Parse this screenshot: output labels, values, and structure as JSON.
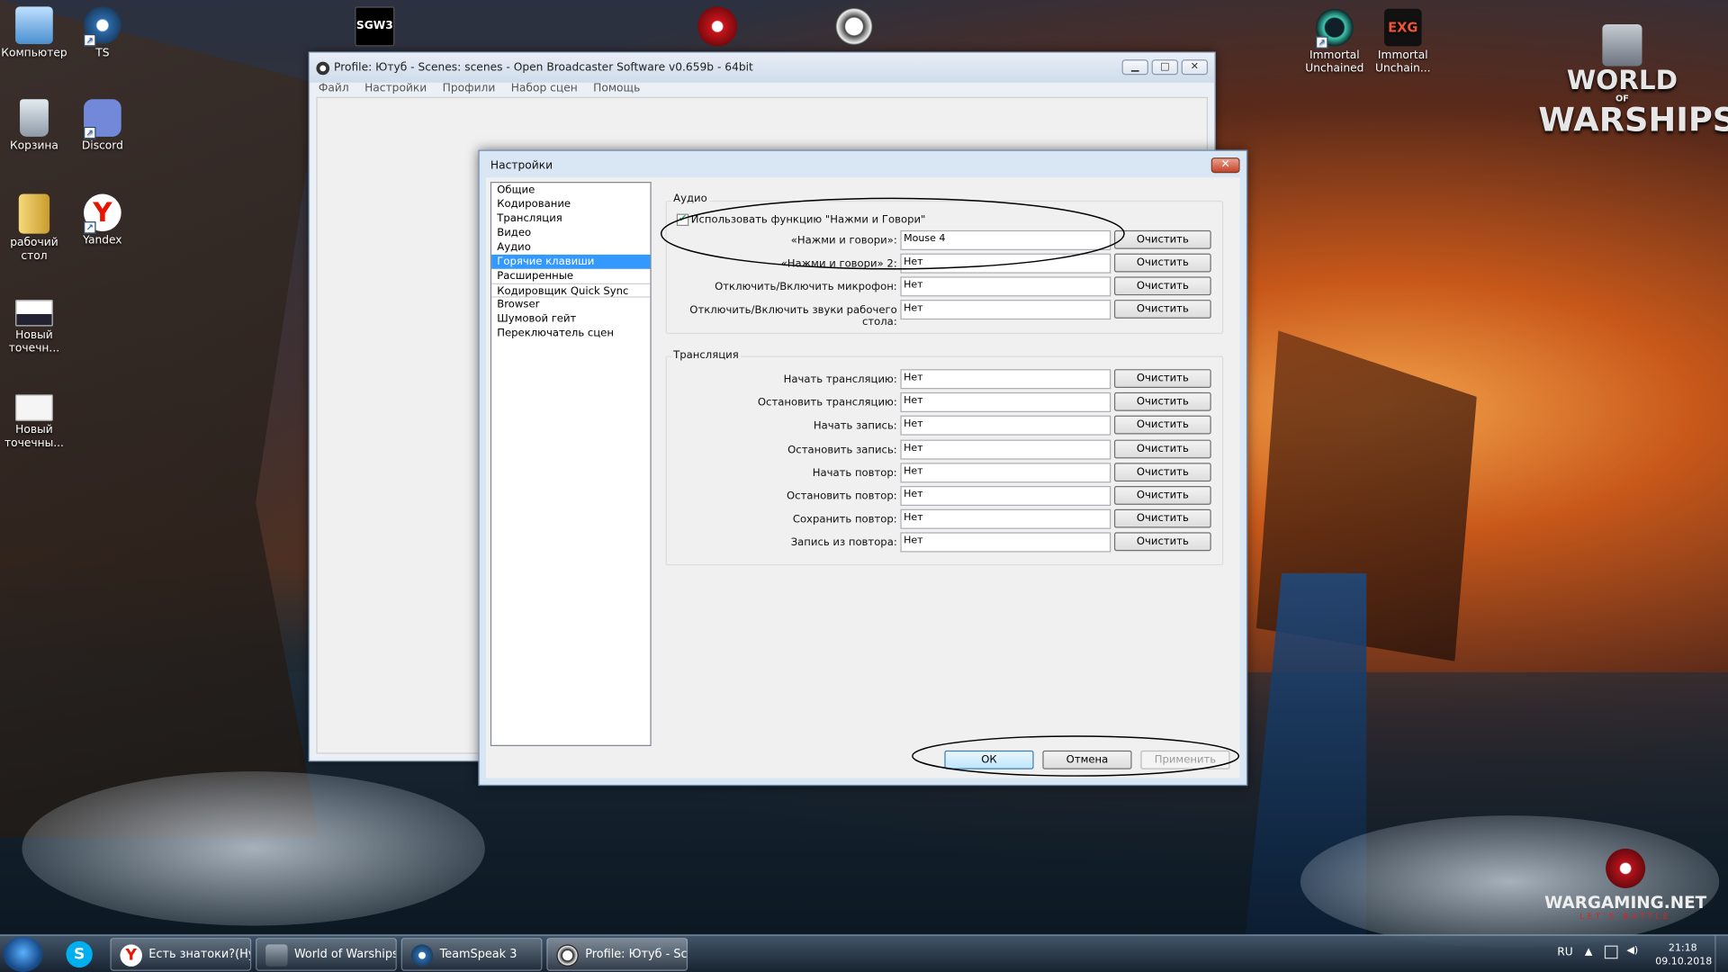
{
  "desktop": {
    "icons": [
      {
        "label": "Компьютер",
        "icon": "computer-icon",
        "color": "#8fc3ff",
        "shortcut": false
      },
      {
        "label": "TS",
        "icon": "teamspeak-icon",
        "color": "#2a6aa8",
        "shortcut": true
      },
      {
        "label": "Корзина",
        "icon": "recycle-bin-icon",
        "color": "#c9d3de",
        "shortcut": false
      },
      {
        "label": "Discord",
        "icon": "discord-icon",
        "color": "#7289da",
        "shortcut": true
      },
      {
        "label": "рабочий стол",
        "icon": "folder-icon",
        "color": "#e8c45a",
        "shortcut": false
      },
      {
        "label": "Yandex",
        "icon": "yandex-browser-icon",
        "color": "#e61400",
        "shortcut": true
      },
      {
        "label": "Новый точечн...",
        "icon": "bitmap-image-icon",
        "color": "#f2f2f2",
        "shortcut": false
      },
      {
        "label": "Новый точечны...",
        "icon": "bitmap-image-icon",
        "color": "#f2f2f2",
        "shortcut": false
      }
    ],
    "right_icons": [
      {
        "label": "Immortal Unchained",
        "icon": "immortal-unchained-icon"
      },
      {
        "label": "Immortal Unchain...",
        "icon": "exe-icon"
      }
    ],
    "top_icons": [
      {
        "icon": "sgw3-icon",
        "text": "SGW3"
      },
      {
        "icon": "wargaming-center-icon"
      },
      {
        "icon": "obs-icon"
      }
    ],
    "logo_line1": "WORLD",
    "logo_line2": "OF",
    "logo_line3": "WARSHIPS",
    "wargaming": "WARGAMING.NET",
    "wargaming_sub": "LET'S BATTLE"
  },
  "obs_window": {
    "title": "Profile: Ютуб - Scenes: scenes - Open Broadcaster Software v0.659b - 64bit",
    "menu": [
      "Файл",
      "Настройки",
      "Профили",
      "Набор сцен",
      "Помощь"
    ],
    "minimize": "▁",
    "maximize": "□",
    "close": "✕"
  },
  "settings": {
    "title": "Настройки",
    "close": "✕",
    "nav": [
      "Общие",
      "Кодирование",
      "Трансляция",
      "Видео",
      "Аудио",
      "Горячие клавиши",
      "Расширенные",
      "Кодировщик Quick Sync",
      "Browser",
      "Шумовой гейт",
      "Переключатель сцен"
    ],
    "selected_nav": "Горячие клавиши",
    "audio_group": "Аудио",
    "push_to_talk_checkbox": "Использовать функцию \"Нажми и Говори\"",
    "push_to_talk_checked": true,
    "audio_rows": [
      {
        "label": "«Нажми и говори»:",
        "value": "Mouse 4",
        "button": "Очистить"
      },
      {
        "label": "«Нажми и говори» 2:",
        "value": "Нет",
        "button": "Очистить"
      },
      {
        "label": "Отключить/Включить микрофон:",
        "value": "Нет",
        "button": "Очистить"
      },
      {
        "label": "Отключить/Включить звуки рабочего стола:",
        "value": "Нет",
        "button": "Очистить"
      }
    ],
    "stream_group": "Трансляция",
    "stream_rows": [
      {
        "label": "Начать трансляцию:",
        "value": "Нет",
        "button": "Очистить"
      },
      {
        "label": "Остановить трансляцию:",
        "value": "Нет",
        "button": "Очистить"
      },
      {
        "label": "Начать запись:",
        "value": "Нет",
        "button": "Очистить"
      },
      {
        "label": "Остановить запись:",
        "value": "Нет",
        "button": "Очистить"
      },
      {
        "label": "Начать повтор:",
        "value": "Нет",
        "button": "Очистить"
      },
      {
        "label": "Остановить повтор:",
        "value": "Нет",
        "button": "Очистить"
      },
      {
        "label": "Сохранить повтор:",
        "value": "Нет",
        "button": "Очистить"
      },
      {
        "label": "Запись из повтора:",
        "value": "Нет",
        "button": "Очистить"
      }
    ],
    "ok": "ОК",
    "cancel": "Отмена",
    "apply": "Применить"
  },
  "taskbar": {
    "items": [
      {
        "label": "Есть знатоки?(Ну...",
        "icon": "yandex-browser-icon",
        "color": "#e61400"
      },
      {
        "label": "World of Warships",
        "icon": "world-of-warships-icon",
        "color": "#5a6a7a"
      },
      {
        "label": "TeamSpeak 3",
        "icon": "teamspeak-icon",
        "color": "#2a6aa8"
      },
      {
        "label": "Profile: Ютуб - Sc...",
        "icon": "obs-icon",
        "color": "#303030"
      }
    ],
    "skype_icon": "skype-icon",
    "lang": "RU",
    "time": "21:18",
    "date": "09.10.2018"
  }
}
